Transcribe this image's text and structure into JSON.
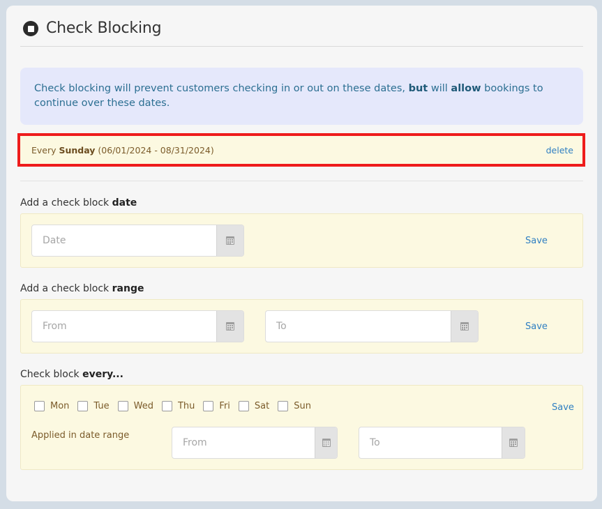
{
  "header": {
    "title": "Check Blocking",
    "icon": "stop-circle-icon"
  },
  "info": {
    "part1": "Check blocking will prevent customers checking in or out on these dates, ",
    "but": "but",
    "part2": " will ",
    "allow": "allow",
    "part3": " bookings to continue over these dates."
  },
  "existing_rule": {
    "prefix": "Every ",
    "day": "Sunday",
    "range": " (06/01/2024 - 08/31/2024)",
    "delete_label": "delete"
  },
  "add_date": {
    "label_prefix": "Add a check block ",
    "label_bold": "date",
    "date_placeholder": "Date",
    "save_label": "Save"
  },
  "add_range": {
    "label_prefix": "Add a check block ",
    "label_bold": "range",
    "from_placeholder": "From",
    "to_placeholder": "To",
    "save_label": "Save"
  },
  "every": {
    "label_prefix": "Check block ",
    "label_bold": "every...",
    "days": [
      {
        "label": "Mon",
        "checked": false
      },
      {
        "label": "Tue",
        "checked": false
      },
      {
        "label": "Wed",
        "checked": false
      },
      {
        "label": "Thu",
        "checked": false
      },
      {
        "label": "Fri",
        "checked": false
      },
      {
        "label": "Sat",
        "checked": false
      },
      {
        "label": "Sun",
        "checked": false
      }
    ],
    "save_label": "Save",
    "applied_label": "Applied in date range",
    "from_placeholder": "From",
    "to_placeholder": "To"
  },
  "colors": {
    "accent_link": "#2f7fc2",
    "highlight_border": "#ee1c1c",
    "info_bg": "#e5e8fb",
    "box_bg": "#fcf9e1"
  }
}
